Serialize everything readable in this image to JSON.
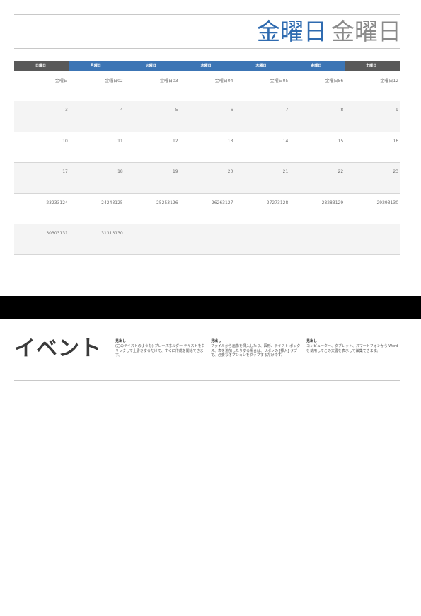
{
  "title": {
    "month": "金曜日",
    "year": "金曜日"
  },
  "calendar": {
    "weekdays": [
      "日曜日",
      "月曜日",
      "火曜日",
      "水曜日",
      "木曜日",
      "金曜日",
      "土曜日"
    ],
    "weeks": [
      [
        "金曜日",
        "金曜日02",
        "金曜日03",
        "金曜日04",
        "金曜日05",
        "金曜日56",
        "金曜日12"
      ],
      [
        "3",
        "4",
        "5",
        "6",
        "7",
        "8",
        "9"
      ],
      [
        "10",
        "11",
        "12",
        "13",
        "14",
        "15",
        "16"
      ],
      [
        "17",
        "18",
        "19",
        "20",
        "21",
        "22",
        "23"
      ],
      [
        "23233124",
        "24243125",
        "25253126",
        "26263127",
        "27273128",
        "28283129",
        "29293130"
      ],
      [
        "30303131",
        "31313130",
        "",
        "",
        "",
        "",
        ""
      ]
    ]
  },
  "events": {
    "title": "イベント",
    "columns": [
      {
        "heading": "見出し",
        "text": "(このテキストのような) プレースホルダー テキストをクリックして上書きするだけで、すぐに作成を開始できます。"
      },
      {
        "heading": "見出し",
        "text": "ファイルから画像を挿入したり、図形、テキスト ボックス、表を追加したりする場合は、リボンの [挿入] タブで、必要なオプションをタップするだけです。"
      },
      {
        "heading": "見出し",
        "text": "コンピューター、タブレット、スマートフォンから Word を使用してこの文書を表示して編集できます。"
      }
    ]
  }
}
